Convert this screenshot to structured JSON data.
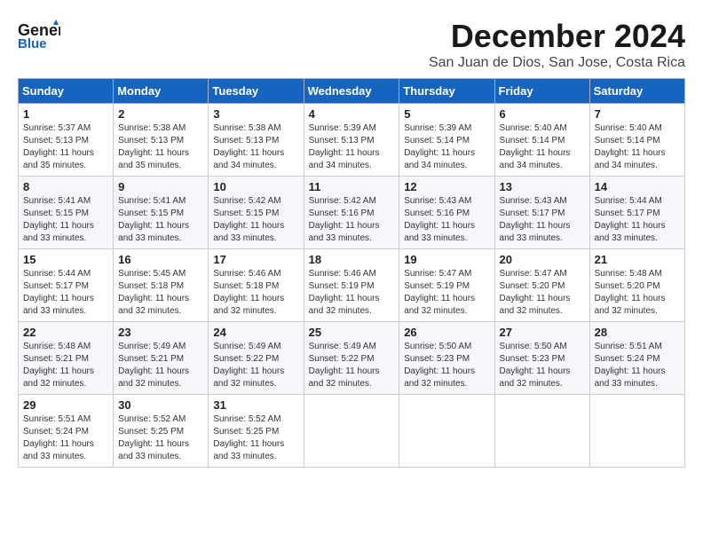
{
  "header": {
    "logo_line1": "General",
    "logo_line2": "Blue",
    "month_title": "December 2024",
    "subtitle": "San Juan de Dios, San Jose, Costa Rica"
  },
  "weekdays": [
    "Sunday",
    "Monday",
    "Tuesday",
    "Wednesday",
    "Thursday",
    "Friday",
    "Saturday"
  ],
  "weeks": [
    [
      {
        "day": "1",
        "sunrise": "5:37 AM",
        "sunset": "5:13 PM",
        "daylight": "11 hours and 35 minutes."
      },
      {
        "day": "2",
        "sunrise": "5:38 AM",
        "sunset": "5:13 PM",
        "daylight": "11 hours and 35 minutes."
      },
      {
        "day": "3",
        "sunrise": "5:38 AM",
        "sunset": "5:13 PM",
        "daylight": "11 hours and 34 minutes."
      },
      {
        "day": "4",
        "sunrise": "5:39 AM",
        "sunset": "5:13 PM",
        "daylight": "11 hours and 34 minutes."
      },
      {
        "day": "5",
        "sunrise": "5:39 AM",
        "sunset": "5:14 PM",
        "daylight": "11 hours and 34 minutes."
      },
      {
        "day": "6",
        "sunrise": "5:40 AM",
        "sunset": "5:14 PM",
        "daylight": "11 hours and 34 minutes."
      },
      {
        "day": "7",
        "sunrise": "5:40 AM",
        "sunset": "5:14 PM",
        "daylight": "11 hours and 34 minutes."
      }
    ],
    [
      {
        "day": "8",
        "sunrise": "5:41 AM",
        "sunset": "5:15 PM",
        "daylight": "11 hours and 33 minutes."
      },
      {
        "day": "9",
        "sunrise": "5:41 AM",
        "sunset": "5:15 PM",
        "daylight": "11 hours and 33 minutes."
      },
      {
        "day": "10",
        "sunrise": "5:42 AM",
        "sunset": "5:15 PM",
        "daylight": "11 hours and 33 minutes."
      },
      {
        "day": "11",
        "sunrise": "5:42 AM",
        "sunset": "5:16 PM",
        "daylight": "11 hours and 33 minutes."
      },
      {
        "day": "12",
        "sunrise": "5:43 AM",
        "sunset": "5:16 PM",
        "daylight": "11 hours and 33 minutes."
      },
      {
        "day": "13",
        "sunrise": "5:43 AM",
        "sunset": "5:17 PM",
        "daylight": "11 hours and 33 minutes."
      },
      {
        "day": "14",
        "sunrise": "5:44 AM",
        "sunset": "5:17 PM",
        "daylight": "11 hours and 33 minutes."
      }
    ],
    [
      {
        "day": "15",
        "sunrise": "5:44 AM",
        "sunset": "5:17 PM",
        "daylight": "11 hours and 33 minutes."
      },
      {
        "day": "16",
        "sunrise": "5:45 AM",
        "sunset": "5:18 PM",
        "daylight": "11 hours and 32 minutes."
      },
      {
        "day": "17",
        "sunrise": "5:46 AM",
        "sunset": "5:18 PM",
        "daylight": "11 hours and 32 minutes."
      },
      {
        "day": "18",
        "sunrise": "5:46 AM",
        "sunset": "5:19 PM",
        "daylight": "11 hours and 32 minutes."
      },
      {
        "day": "19",
        "sunrise": "5:47 AM",
        "sunset": "5:19 PM",
        "daylight": "11 hours and 32 minutes."
      },
      {
        "day": "20",
        "sunrise": "5:47 AM",
        "sunset": "5:20 PM",
        "daylight": "11 hours and 32 minutes."
      },
      {
        "day": "21",
        "sunrise": "5:48 AM",
        "sunset": "5:20 PM",
        "daylight": "11 hours and 32 minutes."
      }
    ],
    [
      {
        "day": "22",
        "sunrise": "5:48 AM",
        "sunset": "5:21 PM",
        "daylight": "11 hours and 32 minutes."
      },
      {
        "day": "23",
        "sunrise": "5:49 AM",
        "sunset": "5:21 PM",
        "daylight": "11 hours and 32 minutes."
      },
      {
        "day": "24",
        "sunrise": "5:49 AM",
        "sunset": "5:22 PM",
        "daylight": "11 hours and 32 minutes."
      },
      {
        "day": "25",
        "sunrise": "5:49 AM",
        "sunset": "5:22 PM",
        "daylight": "11 hours and 32 minutes."
      },
      {
        "day": "26",
        "sunrise": "5:50 AM",
        "sunset": "5:23 PM",
        "daylight": "11 hours and 32 minutes."
      },
      {
        "day": "27",
        "sunrise": "5:50 AM",
        "sunset": "5:23 PM",
        "daylight": "11 hours and 32 minutes."
      },
      {
        "day": "28",
        "sunrise": "5:51 AM",
        "sunset": "5:24 PM",
        "daylight": "11 hours and 33 minutes."
      }
    ],
    [
      {
        "day": "29",
        "sunrise": "5:51 AM",
        "sunset": "5:24 PM",
        "daylight": "11 hours and 33 minutes."
      },
      {
        "day": "30",
        "sunrise": "5:52 AM",
        "sunset": "5:25 PM",
        "daylight": "11 hours and 33 minutes."
      },
      {
        "day": "31",
        "sunrise": "5:52 AM",
        "sunset": "5:25 PM",
        "daylight": "11 hours and 33 minutes."
      },
      null,
      null,
      null,
      null
    ]
  ]
}
